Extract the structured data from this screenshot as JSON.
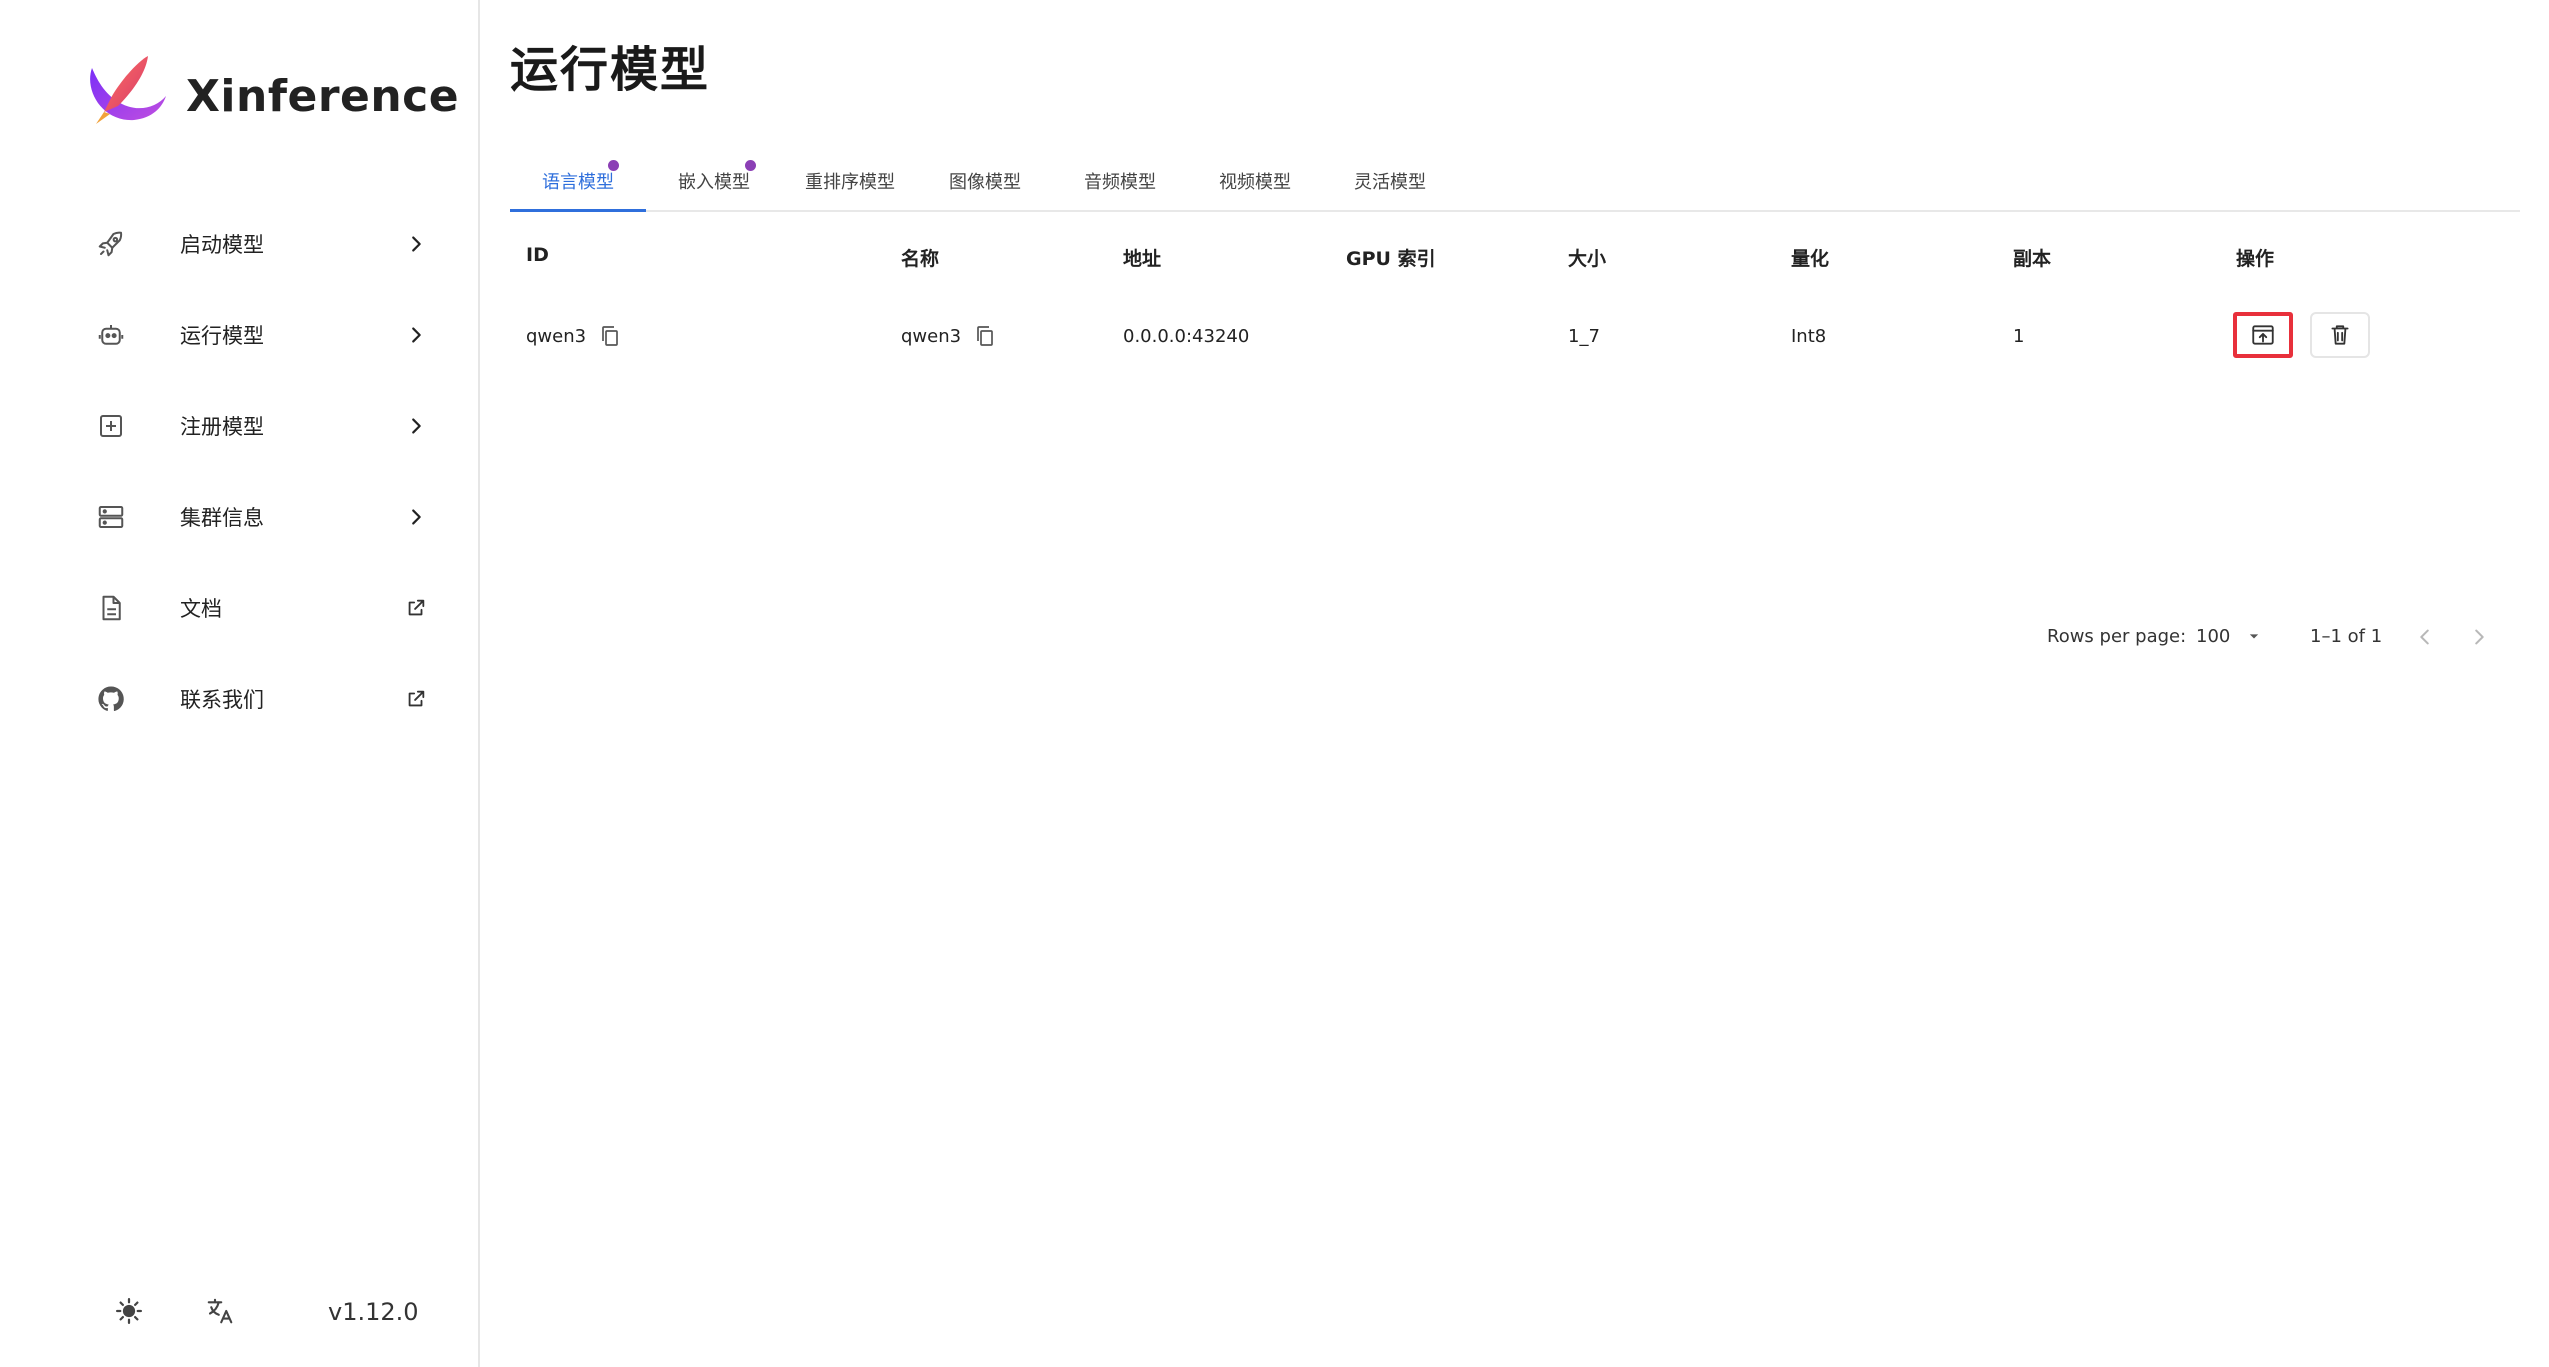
{
  "brand": {
    "name": "Xinference"
  },
  "sidebar": {
    "items": [
      {
        "label": "启动模型",
        "icon": "rocket-icon",
        "trail": "chevron-right-icon"
      },
      {
        "label": "运行模型",
        "icon": "robot-icon",
        "trail": "chevron-right-icon"
      },
      {
        "label": "注册模型",
        "icon": "add-box-icon",
        "trail": "chevron-right-icon"
      },
      {
        "label": "集群信息",
        "icon": "server-icon",
        "trail": "chevron-right-icon"
      },
      {
        "label": "文档",
        "icon": "document-icon",
        "trail": "external-link-icon"
      },
      {
        "label": "联系我们",
        "icon": "github-icon",
        "trail": "external-link-icon"
      }
    ],
    "footer": {
      "version": "v1.12.0",
      "theme_icon": "sun-icon",
      "language_icon": "translate-icon"
    }
  },
  "page": {
    "title": "运行模型"
  },
  "tabs": [
    {
      "label": "语言模型",
      "active": true,
      "dot": true
    },
    {
      "label": "嵌入模型",
      "active": false,
      "dot": true
    },
    {
      "label": "重排序模型",
      "active": false,
      "dot": false
    },
    {
      "label": "图像模型",
      "active": false,
      "dot": false
    },
    {
      "label": "音频模型",
      "active": false,
      "dot": false
    },
    {
      "label": "视频模型",
      "active": false,
      "dot": false
    },
    {
      "label": "灵活模型",
      "active": false,
      "dot": false
    }
  ],
  "table": {
    "columns": [
      "ID",
      "名称",
      "地址",
      "GPU 索引",
      "大小",
      "量化",
      "副本",
      "操作"
    ],
    "rows": [
      {
        "id": "qwen3",
        "name": "qwen3",
        "address": "0.0.0.0:43240",
        "gpu_index": "",
        "size": "1_7",
        "quantization": "Int8",
        "replica": "1"
      }
    ]
  },
  "pagination": {
    "rows_per_page_label": "Rows per page:",
    "rows_per_page": "100",
    "range": "1–1 of 1"
  },
  "colors": {
    "accent": "#2f6fdc",
    "dot": "#8b3fb5",
    "highlight": "#e8303b"
  }
}
